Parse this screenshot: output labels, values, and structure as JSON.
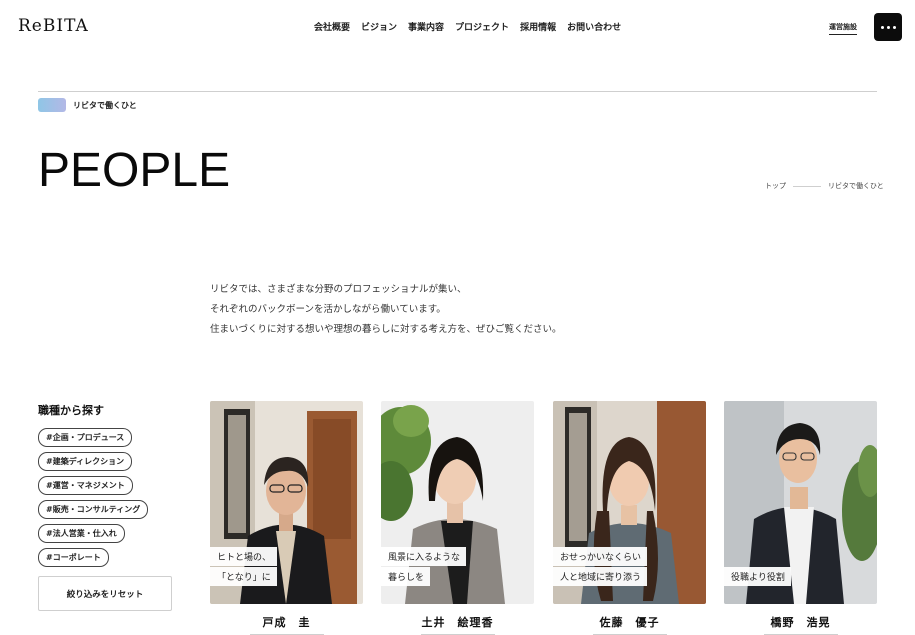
{
  "header": {
    "logo": "ReBITA",
    "nav": [
      "会社概要",
      "ビジョン",
      "事業内容",
      "プロジェクト",
      "採用情報",
      "お問い合わせ"
    ],
    "facility_link": "運営施設",
    "menu_icon": "more-dots-icon"
  },
  "section_label": "リビタで働くひと",
  "page_title": "PEOPLE",
  "breadcrumb": {
    "home": "トップ",
    "current": "リビタで働くひと"
  },
  "intro": {
    "lines": [
      "リビタでは、さまざまな分野のプロフェッショナルが集い、",
      "それぞれのバックボーンを活かしながら働いています。",
      "住まいづくりに対する想いや理想の暮らしに対する考え方を、ぜひご覧ください。"
    ]
  },
  "filter": {
    "title": "職種から探す",
    "tags": [
      "#企画・プロデュース",
      "#建築ディレクション",
      "#運営・マネジメント",
      "#販売・コンサルティング",
      "#法人営業・仕入れ",
      "#コーポレート"
    ],
    "reset_label": "絞り込みをリセット"
  },
  "people": [
    {
      "caption": [
        "ヒトと場の、",
        "「となり」に"
      ],
      "name": "戸成　圭"
    },
    {
      "caption": [
        "風景に入るような",
        "暮らしを"
      ],
      "name": "土井　絵理香"
    },
    {
      "caption": [
        "おせっかいなくらい",
        "人と地域に寄り添う"
      ],
      "name": "佐藤　優子"
    },
    {
      "caption": [
        "役職より役割"
      ],
      "name": "橋野　浩晃"
    }
  ],
  "colors": {
    "accent_gradient_start": "#8fc6e6",
    "accent_gradient_end": "#b3b8e6",
    "menu_button_bg": "#0c0c0c"
  }
}
